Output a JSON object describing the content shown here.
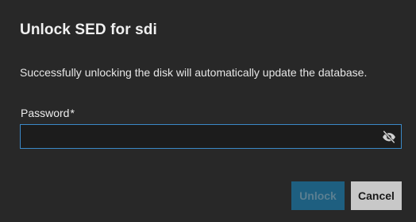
{
  "dialog": {
    "title": "Unlock SED for sdi",
    "message": "Successfully unlocking the disk will automatically update the database."
  },
  "password_field": {
    "label": "Password",
    "required_marker": "*",
    "value": "",
    "placeholder": "",
    "toggle_icon": "eye-off-icon"
  },
  "actions": {
    "unlock_label": "Unlock",
    "cancel_label": "Cancel"
  },
  "colors": {
    "dialog_bg": "#282828",
    "input_border_focus": "#3b88c6",
    "primary_disabled_bg": "#1e5f80",
    "secondary_bg": "#c8c8c8"
  }
}
